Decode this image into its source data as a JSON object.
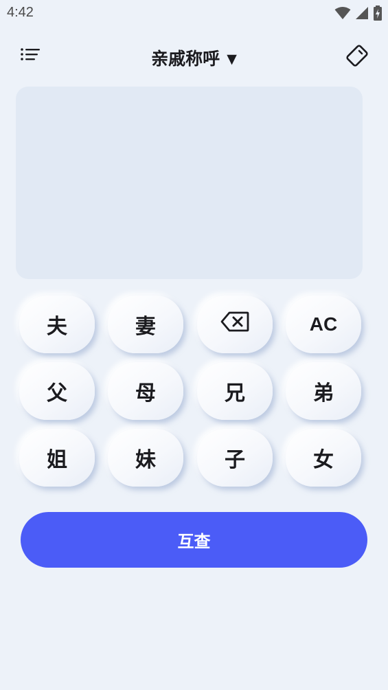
{
  "status_bar": {
    "time": "4:42",
    "icons": [
      "wifi-icon",
      "cellular-signal-icon",
      "battery-charging-icon"
    ]
  },
  "toolbar": {
    "title": "亲戚称呼",
    "caret": "▼",
    "menu_icon": "menu-list-icon",
    "rotate_icon": "screen-rotation-icon"
  },
  "keypad": {
    "row1": [
      "夫",
      "妻",
      "backspace-icon",
      "AC"
    ],
    "row2": [
      "父",
      "母",
      "兄",
      "弟"
    ],
    "row3": [
      "姐",
      "妹",
      "子",
      "女"
    ]
  },
  "cta": {
    "label": "互查"
  },
  "colors": {
    "background": "#edf2f9",
    "display": "#e1e9f4",
    "accent": "#4b5cf7",
    "text": "#1b1b1f"
  }
}
